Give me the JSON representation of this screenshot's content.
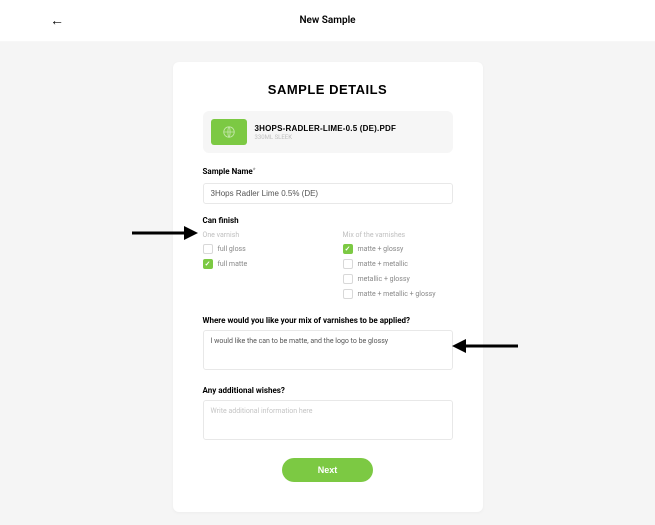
{
  "header": {
    "title": "New Sample"
  },
  "card": {
    "title": "SAMPLE DETAILS",
    "file": {
      "name": "3HOPS-RADLER-LIME-0.5 (DE).PDF",
      "meta": "330ML SLEEK"
    },
    "sample_name": {
      "label": "Sample Name",
      "value": "3Hops Radler Lime 0.5% (DE)"
    },
    "can_finish": {
      "label": "Can finish",
      "one_heading": "One varnish",
      "mix_heading": "Mix of the varnishes",
      "options_one": [
        {
          "label": "full gloss",
          "checked": false
        },
        {
          "label": "full matte",
          "checked": true
        }
      ],
      "options_mix": [
        {
          "label": "matte + glossy",
          "checked": true
        },
        {
          "label": "matte + metallic",
          "checked": false
        },
        {
          "label": "metallic + glossy",
          "checked": false
        },
        {
          "label": "matte + metallic + glossy",
          "checked": false
        }
      ]
    },
    "varnish_mix": {
      "label": "Where would you like your mix of varnishes to be applied?",
      "value": "I would like the can to be matte, and the logo to be glossy"
    },
    "wishes": {
      "label": "Any additional wishes?",
      "placeholder": "Write additional information here"
    },
    "next_label": "Next"
  }
}
